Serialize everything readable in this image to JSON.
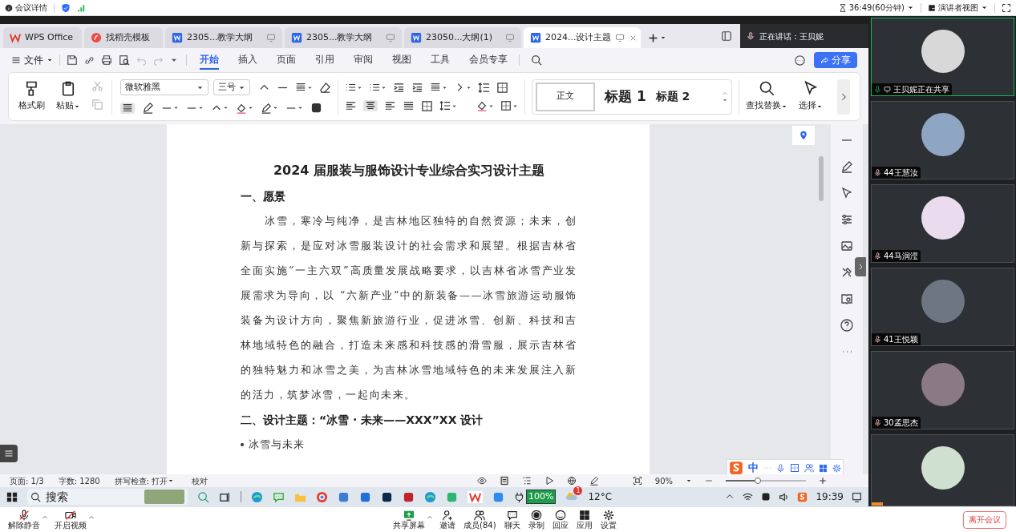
{
  "meeting_bar": {
    "details": "会议详情",
    "timer": "36:49(60分钟)",
    "view": "演讲者视图"
  },
  "tabs": [
    {
      "kind": "home",
      "label": "WPS Office",
      "selected": false
    },
    {
      "kind": "template",
      "label": "找稻壳模板",
      "selected": false
    },
    {
      "kind": "doc",
      "label": "2305...教学大纲",
      "selected": false
    },
    {
      "kind": "doc",
      "label": "2305...教学大纲",
      "selected": false
    },
    {
      "kind": "doc",
      "label": "23050...大纲(1)",
      "selected": false
    },
    {
      "kind": "doc",
      "label": "2024...设计主题",
      "selected": true
    }
  ],
  "speaker": "正在讲话：王贝妮",
  "menu": {
    "file": "文件",
    "tabs": [
      {
        "label": "开始",
        "selected": true
      },
      {
        "label": "插入",
        "selected": false
      },
      {
        "label": "页面",
        "selected": false
      },
      {
        "label": "引用",
        "selected": false
      },
      {
        "label": "审阅",
        "selected": false
      },
      {
        "label": "视图",
        "selected": false
      },
      {
        "label": "工具",
        "selected": false
      },
      {
        "label": "会员专享",
        "selected": false
      }
    ],
    "share": "分享"
  },
  "ribbon": {
    "format_painter": "格式刷",
    "paste": "粘贴",
    "font": "微软雅黑",
    "size": "三号",
    "styles": [
      "正文",
      "标题 1",
      "标题 2"
    ],
    "find_replace": "查找替换",
    "select": "选择"
  },
  "document": {
    "title": "2024 届服装与服饰设计专业综合实习设计主题",
    "blocks": [
      {
        "kind": "heading",
        "text": "一、愿景"
      },
      {
        "kind": "paragraph",
        "text": "冰雪，寒冷与纯净，是吉林地区独特的自然资源；未来，创新与探索，是应对冰雪服装设计的社会需求和展望。根据吉林省全面实施“一主六双”高质量发展战略要求，以吉林省冰雪产业发展需求为导向，以 “六新产业”中的新装备——冰雪旅游运动服饰装备为设计方向，聚焦新旅游行业，促进冰雪、创新、科技和吉林地域特色的融合，打造未来感和科技感的滑雪服，展示吉林省的独特魅力和冰雪之美，为吉林冰雪地域特色的未来发展注入新的活力，筑梦冰雪，一起向未来。"
      },
      {
        "kind": "heading",
        "text": "二、设计主题：“冰雪 · 未来——XXX”XX 设计"
      },
      {
        "kind": "bullet",
        "text": "冰雪与未来"
      }
    ]
  },
  "ime": "中",
  "status_bar": {
    "page": "页面: 1/3",
    "words": "字数: 1280",
    "spell": "拼写检查: 打开",
    "proofread": "校对",
    "zoom": "90%",
    "zoom_slider": {
      "level": 0.4
    }
  },
  "taskbar": {
    "search": "搜索",
    "battery": "100%",
    "weather_badge": "1",
    "temperature": "12°C",
    "time": "19:39"
  },
  "participants": [
    {
      "name": "王贝妮正在共享",
      "selected": true,
      "muted": false,
      "sharing": true
    },
    {
      "name": "44王慧汝",
      "selected": false,
      "muted": true,
      "sharing": false
    },
    {
      "name": "44马润滢",
      "selected": false,
      "muted": true,
      "sharing": false
    },
    {
      "name": "41王悦颖",
      "selected": false,
      "muted": true,
      "sharing": false
    },
    {
      "name": "30孟思杰",
      "selected": false,
      "muted": true,
      "sharing": false
    }
  ],
  "controls": [
    {
      "kind": "unmute",
      "label": "解除静音"
    },
    {
      "kind": "video",
      "label": "开启视频"
    },
    {
      "kind": "share",
      "label": "共享屏幕"
    },
    {
      "kind": "invite",
      "label": "邀请"
    },
    {
      "kind": "members",
      "label": "成员(84)"
    },
    {
      "kind": "chat",
      "label": "聊天"
    },
    {
      "kind": "record",
      "label": "录制"
    },
    {
      "kind": "react",
      "label": "回应"
    },
    {
      "kind": "apps",
      "label": "应用"
    },
    {
      "kind": "settings",
      "label": "设置"
    }
  ],
  "leave": "离开会议"
}
